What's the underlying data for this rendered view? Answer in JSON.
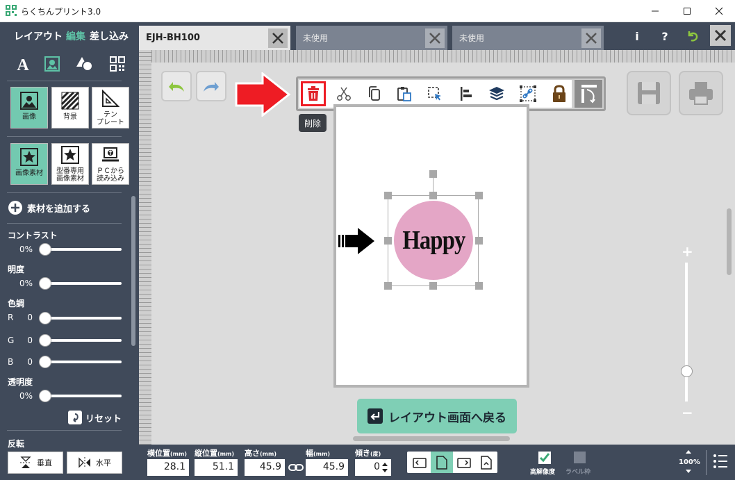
{
  "window": {
    "title": "らくちんプリント3.0",
    "minimize_icon": "minimize-icon",
    "maximize_icon": "maximize-icon",
    "close_icon": "close-icon"
  },
  "modes": {
    "layout": "レイアウト",
    "edit": "編集",
    "merge": "差し込み",
    "active": "edit"
  },
  "tabs": [
    {
      "label": "EJH-BH100",
      "active": true
    },
    {
      "label": "未使用",
      "active": false
    },
    {
      "label": "未使用",
      "active": false
    }
  ],
  "topbar_icons": {
    "info": "i",
    "help": "?"
  },
  "left_panel": {
    "tool_icons": [
      "text-icon",
      "image-icon",
      "shape-icon",
      "qr-code-icon"
    ],
    "categories": [
      {
        "label": "画像",
        "selected": true
      },
      {
        "label": "背景",
        "selected": false
      },
      {
        "label": "テン\nプレート",
        "selected": false
      }
    ],
    "sources": [
      {
        "label": "画像素材",
        "selected": true
      },
      {
        "label": "型番専用\n画像素材",
        "selected": false
      },
      {
        "label": "ＰＣから\n読み込み",
        "selected": false
      }
    ],
    "add_material": "素材を追加する",
    "contrast": {
      "label": "コントラスト",
      "value": "0%"
    },
    "brightness": {
      "label": "明度",
      "value": "0%"
    },
    "color_tone": {
      "label": "色調",
      "r_label": "R",
      "r": "0",
      "g_label": "G",
      "g": "0",
      "b_label": "B",
      "b": "0"
    },
    "transparency": {
      "label": "透明度",
      "value": "0%"
    },
    "reset": "リセット",
    "flip": {
      "label": "反転",
      "vertical": "垂直",
      "horizontal": "水平"
    }
  },
  "edit_toolbar": {
    "icons": [
      "trash-icon",
      "scissors-icon",
      "copy-icon",
      "paste-icon",
      "select-icon",
      "align-icon",
      "layers-icon",
      "group-link-icon",
      "lock-icon",
      "rotate-icon"
    ],
    "tooltip": "削除"
  },
  "canvas": {
    "image_text": "Happy",
    "back_button": "レイアウト画面へ戻る",
    "colors": {
      "circle": "#e4a6c6",
      "accent": "#7fcfb5",
      "highlight": "#ee1c24"
    },
    "zoom_plus": "+",
    "zoom_minus": "−"
  },
  "bottom_bar": {
    "x_label": "横位置",
    "x_unit": "(mm)",
    "x_value": "28.1",
    "y_label": "縦位置",
    "y_unit": "(mm)",
    "y_value": "51.1",
    "h_label": "高さ",
    "h_unit": "(mm)",
    "h_value": "45.9",
    "w_label": "幅",
    "w_unit": "(mm)",
    "w_value": "45.9",
    "angle_label": "傾き",
    "angle_unit": "(度)",
    "angle_value": "0",
    "high_res": "高解像度",
    "label_frame": "ラベル枠",
    "zoom": "100%"
  }
}
